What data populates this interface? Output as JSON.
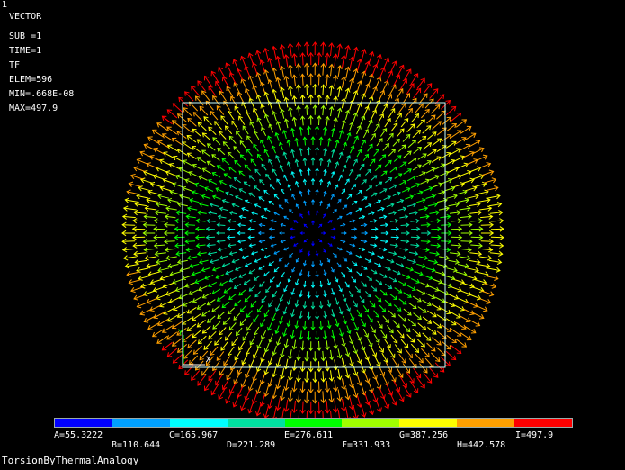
{
  "window": {
    "frame_number": "1",
    "title_line": "VECTOR"
  },
  "info": {
    "lines": [
      "SUB =1",
      "TIME=1",
      "TF",
      "ELEM=596",
      "MIN=.668E-08",
      "MAX=497.9"
    ]
  },
  "triad": {
    "x_label": "X",
    "y_label": "Y"
  },
  "legend": {
    "colors": [
      "#0000ff",
      "#00a0ff",
      "#00ffff",
      "#00e0a0",
      "#00ff00",
      "#a0ff00",
      "#ffff00",
      "#ffa000",
      "#ff0000"
    ],
    "row1": [
      "A=55.3222",
      "C=165.967",
      "E=276.611",
      "G=387.256",
      "I=497.9"
    ],
    "row2": [
      "B=110.644",
      "D=221.289",
      "F=331.933",
      "H=442.578"
    ]
  },
  "footer": {
    "job_title": "TorsionByThermalAnalogy"
  },
  "field": {
    "min": 6.68e-09,
    "max": 497.9
  },
  "colors": {
    "box_outline": "#c8ffff",
    "background": "#000000"
  }
}
